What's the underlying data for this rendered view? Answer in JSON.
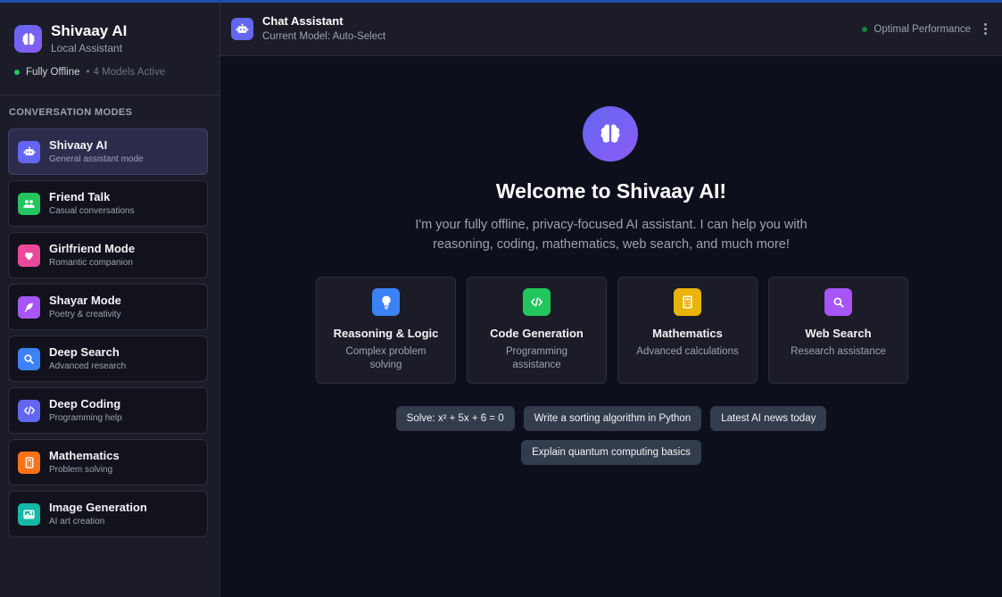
{
  "sidebar": {
    "brand": {
      "title": "Shivaay AI",
      "subtitle": "Local Assistant"
    },
    "status": {
      "online": "Fully Offline",
      "separator": "•",
      "models": "4 Models Active"
    },
    "section_label": "CONVERSATION MODES",
    "modes": [
      {
        "title": "Shivaay AI",
        "desc": "General assistant mode",
        "icon": "robot-icon",
        "color": "#6366f1"
      },
      {
        "title": "Friend Talk",
        "desc": "Casual conversations",
        "icon": "users-icon",
        "color": "#22c55e"
      },
      {
        "title": "Girlfriend Mode",
        "desc": "Romantic companion",
        "icon": "heart-icon",
        "color": "#ec4899"
      },
      {
        "title": "Shayar Mode",
        "desc": "Poetry & creativity",
        "icon": "feather-icon",
        "color": "#a855f7"
      },
      {
        "title": "Deep Search",
        "desc": "Advanced research",
        "icon": "search-icon",
        "color": "#3b82f6"
      },
      {
        "title": "Deep Coding",
        "desc": "Programming help",
        "icon": "code-icon",
        "color": "#6366f1"
      },
      {
        "title": "Mathematics",
        "desc": "Problem solving",
        "icon": "calculator-icon",
        "color": "#f97316"
      },
      {
        "title": "Image Generation",
        "desc": "AI art creation",
        "icon": "image-icon",
        "color": "#14b8a6"
      }
    ]
  },
  "header": {
    "title": "Chat Assistant",
    "subtitle": "Current Model: Auto-Select",
    "performance": "Optimal Performance"
  },
  "main": {
    "welcome": "Welcome to Shivaay AI!",
    "intro": "I'm your fully offline, privacy-focused AI assistant. I can help you with reasoning, coding, mathematics, web search, and much more!",
    "features": [
      {
        "title": "Reasoning & Logic",
        "desc": "Complex problem solving",
        "icon": "lightbulb-icon",
        "color": "#3b82f6"
      },
      {
        "title": "Code Generation",
        "desc": "Programming assistance",
        "icon": "code-icon",
        "color": "#22c55e"
      },
      {
        "title": "Mathematics",
        "desc": "Advanced calculations",
        "icon": "calculator-icon",
        "color": "#eab308"
      },
      {
        "title": "Web Search",
        "desc": "Research assistance",
        "icon": "search-icon",
        "color": "#a855f7"
      }
    ],
    "suggestions": [
      "Solve: x² + 5x + 6 = 0",
      "Write a sorting algorithm in Python",
      "Latest AI news today",
      "Explain quantum computing basics"
    ]
  },
  "colors": {
    "accent": "#6366f1",
    "online": "#22c55e",
    "background": "#0e0f1c",
    "panel": "#1b1c27"
  }
}
